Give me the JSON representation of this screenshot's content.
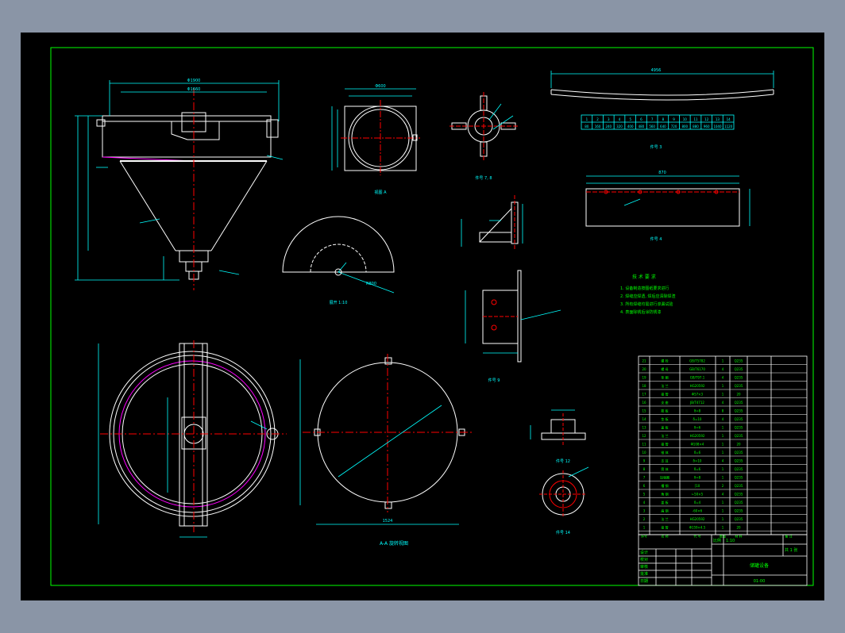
{
  "colors": {
    "background": "#000000",
    "frame": "#00ff00",
    "outline": "#ffffff",
    "dimension": "#00ffff",
    "centerline": "#ff0000",
    "hidden_edge": "#ff00ff",
    "table_text": "#00ff00",
    "note_text": "#00ff00"
  },
  "labels": {
    "front_view_top_dim": "Φ1900",
    "front_view_inner_dim": "Φ1660",
    "section_bottom": "",
    "plan_view_title": "A-A 旋转视图",
    "sector_dim": "R800",
    "cylinder_top_dim": "750",
    "ring_dim": "Φ600",
    "plate_dim": "1524",
    "bar_dim": "Φ50",
    "strip_dim": "4956",
    "plate_right_dim": "870",
    "title_block_name": "储罐设备"
  },
  "notes": {
    "title": "技 术 要 求",
    "lines": [
      "1. 设备制造按图纸要求进行",
      "2. 焊缝应焊透, 焊后应清除焊渣",
      "3. 所有焊缝均需进行渗漏试验",
      "4. 表面除锈后涂防锈漆"
    ]
  },
  "view_captions": {
    "front": "",
    "plan": "",
    "sector": "展开 1:10",
    "ring": "视图 A",
    "plate": "视图 B",
    "clamp": "件号 7, 8",
    "bracket": "件号 9",
    "small_top": "件号 12",
    "small_bottom": "件号 14",
    "strip": "件号 3",
    "plate_right": "件号 4"
  },
  "strip_table": {
    "row1": [
      "1",
      "2",
      "3",
      "4",
      "5",
      "6",
      "7",
      "8",
      "9",
      "10",
      "11",
      "12",
      "13",
      "14"
    ],
    "row2": [
      "80",
      "160",
      "240",
      "320",
      "400",
      "480",
      "560",
      "640",
      "720",
      "800",
      "880",
      "960",
      "1040",
      "1120"
    ]
  },
  "parts_table": {
    "rows": [
      [
        "21",
        "螺 栓",
        "GB/T5782",
        "1",
        "Q235",
        ""
      ],
      [
        "20",
        "螺 母",
        "GB/T6170",
        "4",
        "Q235",
        ""
      ],
      [
        "19",
        "垫 圈",
        "GB/T97.1",
        "4",
        "Q235",
        ""
      ],
      [
        "18",
        "法 兰",
        "HG20592",
        "1",
        "Q235",
        ""
      ],
      [
        "17",
        "接 管",
        "Φ57×3",
        "1",
        "20",
        ""
      ],
      [
        "16",
        "支 座",
        "JB/T4712",
        "4",
        "Q235",
        ""
      ],
      [
        "15",
        "筋 板",
        "δ=8",
        "8",
        "Q235",
        ""
      ],
      [
        "14",
        "垫 板",
        "δ=10",
        "4",
        "Q235",
        ""
      ],
      [
        "13",
        "盖 板",
        "δ=6",
        "1",
        "Q235",
        ""
      ],
      [
        "12",
        "法 兰",
        "HG20592",
        "1",
        "Q235",
        ""
      ],
      [
        "11",
        "接 管",
        "Φ108×4",
        "1",
        "20",
        ""
      ],
      [
        "10",
        "锥 体",
        "δ=6",
        "1",
        "Q235",
        ""
      ],
      [
        "9",
        "支 耳",
        "δ=10",
        "4",
        "Q235",
        ""
      ],
      [
        "8",
        "筒 体",
        "δ=6",
        "1",
        "Q235",
        ""
      ],
      [
        "7",
        "加强圈",
        "δ=8",
        "1",
        "Q235",
        ""
      ],
      [
        "6",
        "槽 钢",
        "[10",
        "2",
        "Q235",
        ""
      ],
      [
        "5",
        "角 钢",
        "∟50×5",
        "4",
        "Q235",
        ""
      ],
      [
        "4",
        "盖 板",
        "δ=4",
        "1",
        "Q235",
        ""
      ],
      [
        "3",
        "扁 钢",
        "-60×6",
        "1",
        "Q235",
        ""
      ],
      [
        "2",
        "法 兰",
        "HG20592",
        "1",
        "Q235",
        ""
      ],
      [
        "1",
        "接 管",
        "Φ159×4.5",
        "1",
        "20",
        ""
      ]
    ],
    "header": [
      "序号",
      "名 称",
      "代 号",
      "数量",
      "材 料",
      "备 注"
    ]
  },
  "title_block": {
    "labels": [
      "设计",
      "校对",
      "审核",
      "批准",
      "日期"
    ],
    "scale_label": "比例",
    "scale": "1:10",
    "sheet_label": "共 1 张",
    "drawing_no": "01-00"
  }
}
